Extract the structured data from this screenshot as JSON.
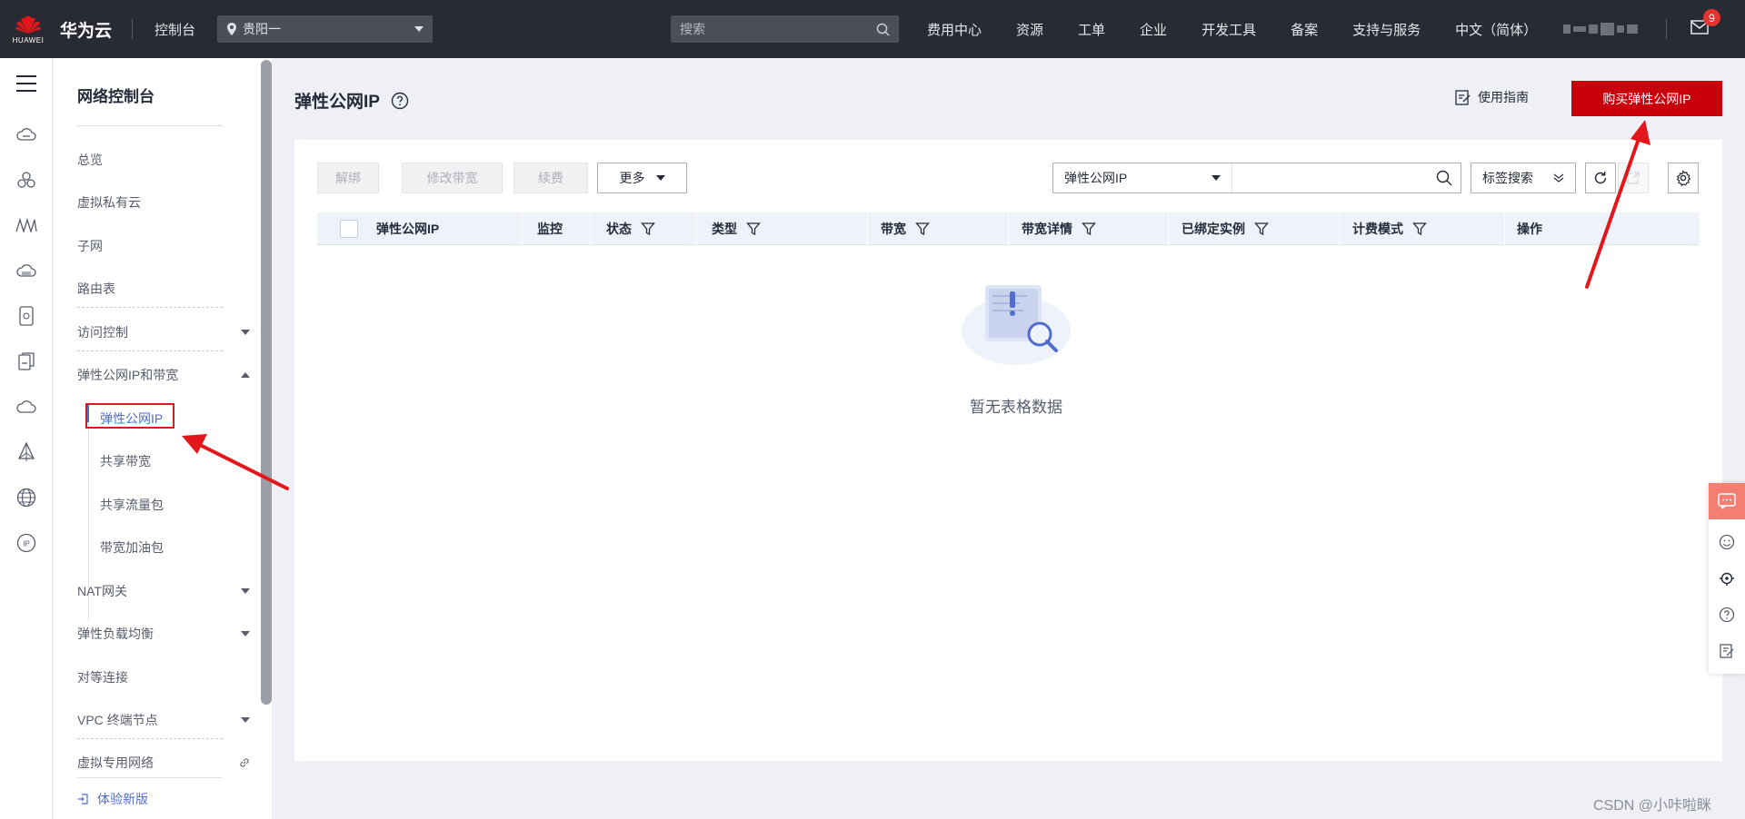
{
  "topbar": {
    "logo_text": "HUAWEI",
    "brand": "华为云",
    "console": "控制台",
    "region": "贵阳一",
    "search_placeholder": "搜索",
    "nav": [
      "费用中心",
      "资源",
      "工单",
      "企业",
      "开发工具",
      "备案",
      "支持与服务",
      "中文（简体）"
    ],
    "mail_badge": "9"
  },
  "rail_icons": [
    "menu-icon",
    "cloud-server-icon",
    "cluster-icon",
    "bandwidth-icon",
    "cloud-storage-icon",
    "database-icon",
    "document-icon",
    "cloud-icon",
    "network-icon",
    "globe-icon",
    "ip-icon"
  ],
  "sidenav": {
    "title": "网络控制台",
    "items": [
      {
        "label": "总览"
      },
      {
        "label": "虚拟私有云"
      },
      {
        "label": "子网"
      },
      {
        "label": "路由表"
      },
      {
        "label": "访问控制"
      },
      {
        "label": "弹性公网IP和带宽"
      },
      {
        "label": "NAT网关"
      },
      {
        "label": "弹性负载均衡"
      },
      {
        "label": "对等连接"
      },
      {
        "label": "VPC 终端节点"
      },
      {
        "label": "虚拟专用网络"
      }
    ],
    "subitems": [
      "弹性公网IP",
      "共享带宽",
      "共享流量包",
      "带宽加油包"
    ],
    "new_version": "体验新版"
  },
  "page": {
    "title": "弹性公网IP",
    "guide": "使用指南",
    "buy_button": "购买弹性公网IP"
  },
  "toolbar": {
    "unbind": "解绑",
    "modify_bandwidth": "修改带宽",
    "renew": "续费",
    "more": "更多",
    "filter_select": "弹性公网IP",
    "tag_search": "标签搜索"
  },
  "table": {
    "columns": [
      "弹性公网IP",
      "监控",
      "状态",
      "类型",
      "带宽",
      "带宽详情",
      "已绑定实例",
      "计费模式",
      "操作"
    ],
    "empty_text": "暂无表格数据"
  },
  "watermark": "CSDN @小咔啦眯",
  "colors": {
    "brand_red": "#c7000b",
    "topbar": "#282b33",
    "link_blue": "#526ecc",
    "annotation_red": "#e3161b"
  }
}
